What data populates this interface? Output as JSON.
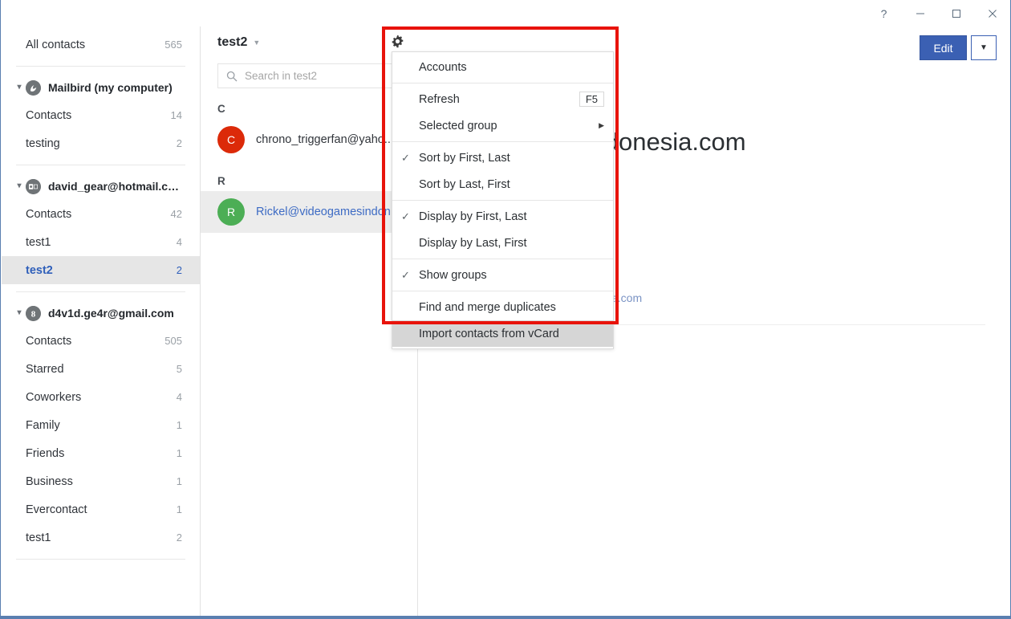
{
  "window": {
    "controls": [
      {
        "name": "help",
        "glyph": "?"
      },
      {
        "name": "minimize",
        "glyph": "—"
      },
      {
        "name": "maximize",
        "glyph": "□"
      },
      {
        "name": "close",
        "glyph": "✕"
      }
    ]
  },
  "sidebar": {
    "all_contacts": {
      "label": "All contacts",
      "count": "565"
    },
    "accounts": [
      {
        "name": "Mailbird (my computer)",
        "icon": "mailbird-icon",
        "expanded": true,
        "folders": [
          {
            "label": "Contacts",
            "count": "14",
            "selected": false
          },
          {
            "label": "testing",
            "count": "2",
            "selected": false
          }
        ]
      },
      {
        "name": "david_gear@hotmail.com",
        "icon": "outlook-icon",
        "expanded": true,
        "folders": [
          {
            "label": "Contacts",
            "count": "42",
            "selected": false
          },
          {
            "label": "test1",
            "count": "4",
            "selected": false
          },
          {
            "label": "test2",
            "count": "2",
            "selected": true
          }
        ]
      },
      {
        "name": "d4v1d.ge4r@gmail.com",
        "icon": "google-icon",
        "expanded": true,
        "folders": [
          {
            "label": "Contacts",
            "count": "505",
            "selected": false
          },
          {
            "label": "Starred",
            "count": "5",
            "selected": false
          },
          {
            "label": "Coworkers",
            "count": "4",
            "selected": false
          },
          {
            "label": "Family",
            "count": "1",
            "selected": false
          },
          {
            "label": "Friends",
            "count": "1",
            "selected": false
          },
          {
            "label": "Business",
            "count": "1",
            "selected": false
          },
          {
            "label": "Evercontact",
            "count": "1",
            "selected": false
          },
          {
            "label": "test1",
            "count": "2",
            "selected": false
          }
        ]
      }
    ]
  },
  "contact_list": {
    "title": "test2",
    "add_contact_label": "add-contact",
    "search": {
      "placeholder": "Search in test2",
      "value": ""
    },
    "groups": [
      {
        "letter": "C",
        "contacts": [
          {
            "name": "chrono_triggerfan@yaho...",
            "initial": "C",
            "avatar_color": "#dc2a09",
            "selected": false
          }
        ]
      },
      {
        "letter": "R",
        "contacts": [
          {
            "name": "Rickel@videogamesindon...",
            "initial": "R",
            "avatar_color": "#4cae55",
            "selected": true
          }
        ]
      }
    ]
  },
  "detail": {
    "edit_label": "Edit",
    "edit_dropdown_label": "edit-options",
    "email_heading": "@videogamesindonesia.com",
    "email_link_fragment": "a.com"
  },
  "menu": {
    "gear_label": "settings-gear",
    "items": [
      {
        "label": "Accounts",
        "checked": false,
        "shortcut": "",
        "submenu": false,
        "highlighted": false,
        "separator_after": true
      },
      {
        "label": "Refresh",
        "checked": false,
        "shortcut": "F5",
        "submenu": false,
        "highlighted": false,
        "separator_after": false
      },
      {
        "label": "Selected group",
        "checked": false,
        "shortcut": "",
        "submenu": true,
        "highlighted": false,
        "separator_after": true
      },
      {
        "label": "Sort by First, Last",
        "checked": true,
        "shortcut": "",
        "submenu": false,
        "highlighted": false,
        "separator_after": false
      },
      {
        "label": "Sort by Last, First",
        "checked": false,
        "shortcut": "",
        "submenu": false,
        "highlighted": false,
        "separator_after": true
      },
      {
        "label": "Display by First, Last",
        "checked": true,
        "shortcut": "",
        "submenu": false,
        "highlighted": false,
        "separator_after": false
      },
      {
        "label": "Display by Last, First",
        "checked": false,
        "shortcut": "",
        "submenu": false,
        "highlighted": false,
        "separator_after": true
      },
      {
        "label": "Show groups",
        "checked": true,
        "shortcut": "",
        "submenu": false,
        "highlighted": false,
        "separator_after": true
      },
      {
        "label": "Find and merge duplicates",
        "checked": false,
        "shortcut": "",
        "submenu": false,
        "highlighted": false,
        "separator_after": false
      },
      {
        "label": "Import contacts from vCard",
        "checked": false,
        "shortcut": "",
        "submenu": false,
        "highlighted": true,
        "separator_after": false
      }
    ]
  },
  "annotation": {
    "highlight_color": "#e8130b"
  }
}
